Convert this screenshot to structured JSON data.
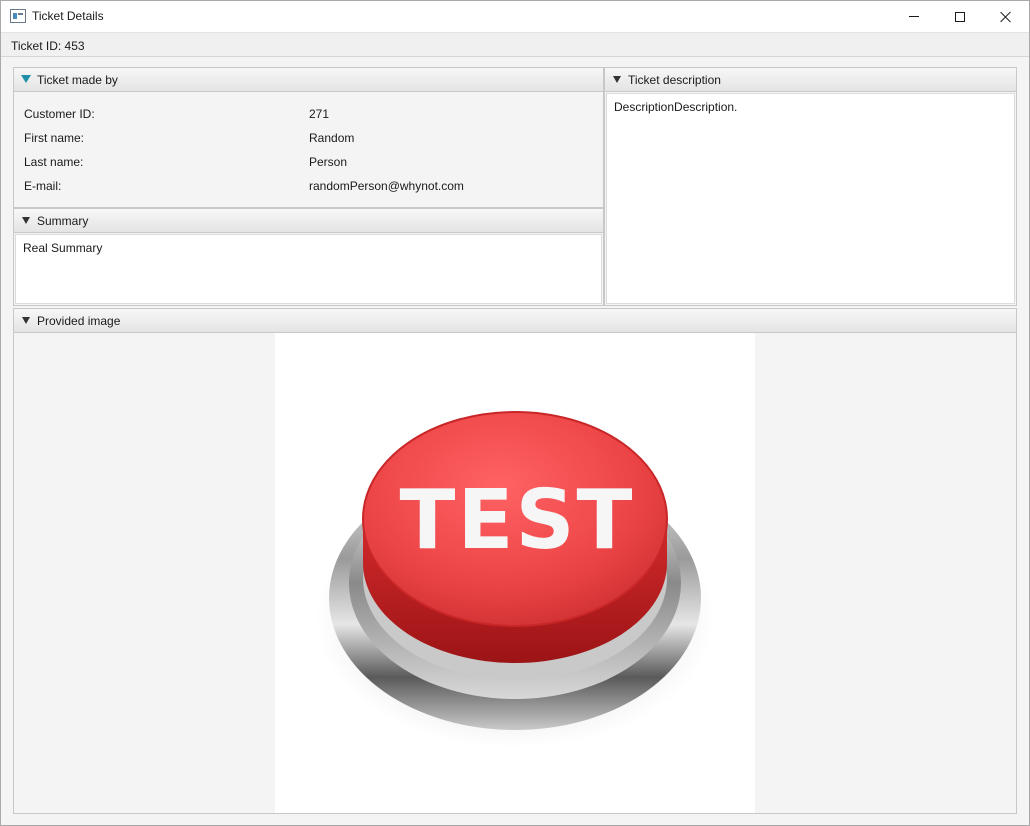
{
  "window": {
    "title": "Ticket Details",
    "controls": {
      "minimize": "minimize-icon",
      "maximize": "maximize-icon",
      "close": "close-icon"
    }
  },
  "ticket": {
    "id_label": "Ticket ID: 453"
  },
  "made_by": {
    "header": "Ticket made by",
    "fields": [
      {
        "label": "Customer ID:",
        "value": "271"
      },
      {
        "label": "First name:",
        "value": "Random"
      },
      {
        "label": "Last name:",
        "value": "Person"
      },
      {
        "label": "E-mail:",
        "value": "randomPerson@whynot.com"
      }
    ]
  },
  "summary": {
    "header": "Summary",
    "text": "Real Summary"
  },
  "description": {
    "header": "Ticket description",
    "text": "DescriptionDescription."
  },
  "provided_image": {
    "header": "Provided image",
    "image_text": "TEST",
    "colors": {
      "button_red": "#e8393b",
      "metal": "#b7b7b7"
    }
  },
  "colors": {
    "accent": "#1f8fa8",
    "header_bg": "#e9e9e9",
    "panel_bg": "#f4f4f4"
  }
}
